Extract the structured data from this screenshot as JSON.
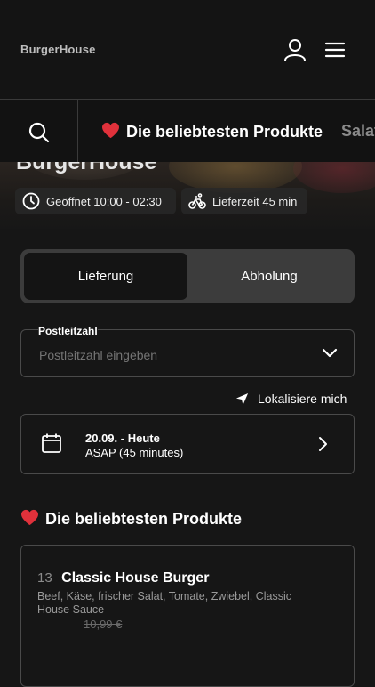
{
  "header": {
    "brand": "BurgerHouse",
    "user_icon": "user-icon",
    "menu_icon": "hamburger-menu-icon"
  },
  "categories": {
    "search_icon": "search-icon",
    "active": "Die beliebtesten Produkte",
    "next": "Salat"
  },
  "hero": {
    "title": "BurgerHouse",
    "opening_hours": "Geöffnet 10:00 - 02:30",
    "delivery_time": "Lieferzeit 45 min"
  },
  "mode_toggle": {
    "delivery": "Lieferung",
    "pickup": "Abholung",
    "selected": "Lieferung"
  },
  "postal_code": {
    "label": "Postleitzahl",
    "placeholder": "Postleitzahl eingeben",
    "value": ""
  },
  "locate": {
    "label": "Lokalisiere mich"
  },
  "delivery_date": {
    "date": "20.09. - Heute",
    "time": "ASAP (45 minutes)"
  },
  "popular": {
    "title": "Die beliebtesten Produkte",
    "products": [
      {
        "number": "13",
        "name": "Classic House Burger",
        "description": "Beef, Käse, frischer Salat, Tomate, Zwiebel, Classic House Sauce",
        "old_price": "10,99 €"
      }
    ]
  },
  "colors": {
    "background": "#161616",
    "accent_heart": "#e0313b",
    "toggle_selected": "#141414",
    "toggle_bg": "#3c3c3c"
  }
}
